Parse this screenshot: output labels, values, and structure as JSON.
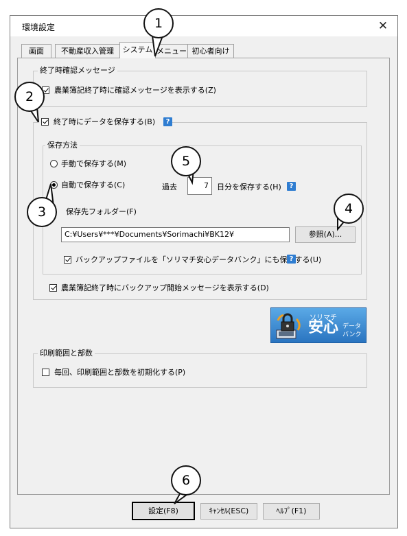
{
  "window": {
    "title": "環境設定",
    "close_label": "✕"
  },
  "tabs": [
    {
      "label": "画面",
      "active": false
    },
    {
      "label": "不動産収入管理",
      "active": false
    },
    {
      "label": "システム",
      "active": true
    },
    {
      "label": "メニュー",
      "active": false
    },
    {
      "label": "初心者向け",
      "active": false
    }
  ],
  "exit_confirm": {
    "legend": "終了時確認メッセージ",
    "show_confirm_label": "農業簿記終了時に確認メッセージを表示する(Z)",
    "show_confirm_checked": true
  },
  "save_on_exit": {
    "label": "終了時にデータを保存する(B)",
    "checked": true,
    "help": "?",
    "method_legend": "保存方法",
    "manual_label": "手動で保存する(M)",
    "auto_label": "自動で保存する(C)",
    "selected": "auto",
    "past_label": "過去",
    "days_value": "7",
    "days_suffix_label": "日分を保存する(H)",
    "folder_label": "保存先フォルダー(F)",
    "folder_path": "C:¥Users¥***¥Documents¥Sorimachi¥BK12¥",
    "browse_label": "参照(A)...",
    "backup_label": "バックアップファイルを「ソリマチ安心データバンク」にも保存する(U)",
    "backup_checked": true,
    "start_msg_label": "農業簿記終了時にバックアップ開始メッセージを表示する(D)",
    "start_msg_checked": true
  },
  "logo": {
    "line1": "ソリマチ",
    "line2": "安心",
    "line3a": "データ",
    "line3b": "バンク"
  },
  "print": {
    "legend": "印刷範囲と部数",
    "reset_label": "毎回、印刷範囲と部数を初期化する(P)",
    "reset_checked": false
  },
  "buttons": {
    "ok": "設定(F8)",
    "cancel": "ｷｬﾝｾﾙ(ESC)",
    "help": "ﾍﾙﾌﾟ(F1)"
  },
  "callouts": [
    "1",
    "2",
    "3",
    "4",
    "5",
    "6"
  ],
  "colors": {
    "help_icon": "#2f7dd1",
    "logo_blue": "#2a74c0"
  }
}
